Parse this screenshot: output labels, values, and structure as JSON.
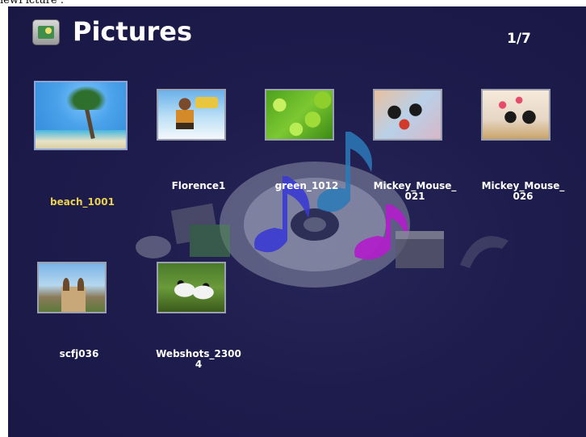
{
  "caption": "iewPicture :",
  "header": {
    "title": "Pictures",
    "icon": "pictures-folder-icon",
    "page_counter": "1/7"
  },
  "selected_index": 0,
  "items": [
    {
      "label": "beach_1001",
      "selected": true
    },
    {
      "label": "Florence1",
      "selected": false
    },
    {
      "label": "green_1012",
      "selected": false
    },
    {
      "label": "Mickey_Mouse_\n021",
      "selected": false
    },
    {
      "label": "Mickey_Mouse_\n026",
      "selected": false
    },
    {
      "label": "scfj036",
      "selected": false
    },
    {
      "label": "Webshots_2300\n4",
      "selected": false
    }
  ],
  "colors": {
    "background": "#1e1c4c",
    "label": "#ffffff",
    "selected_label": "#e8d050",
    "selected_border": "#8ea4d6"
  }
}
